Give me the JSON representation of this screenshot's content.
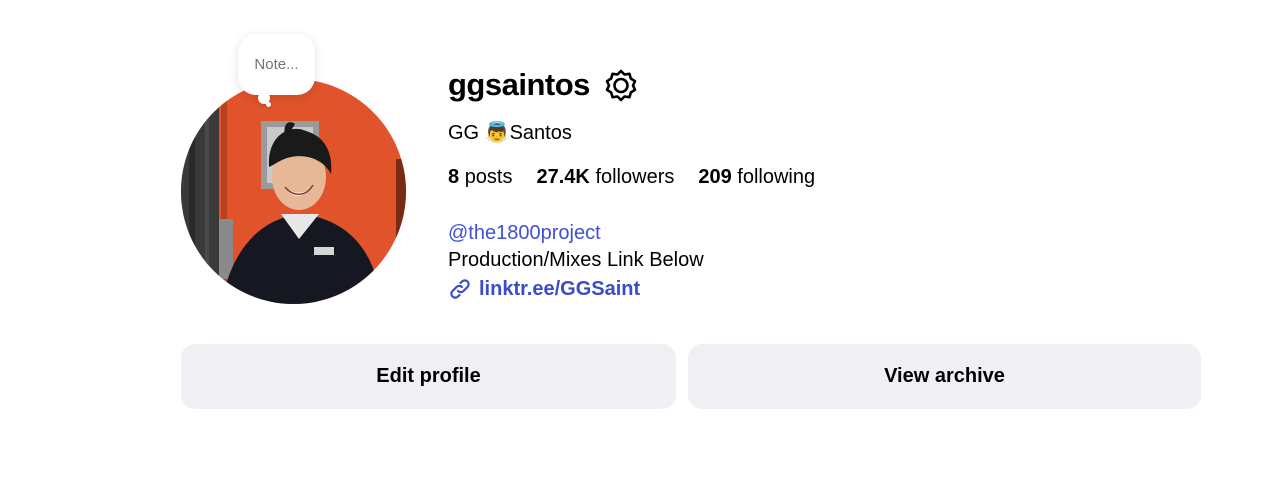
{
  "profile": {
    "note_placeholder": "Note...",
    "username": "ggsaintos",
    "full_name": "GG 👼Santos",
    "stats": {
      "posts_count": "8",
      "posts_label": "posts",
      "followers_count": "27.4K",
      "followers_label": "followers",
      "following_count": "209",
      "following_label": "following"
    },
    "bio": {
      "mention": "@the1800project",
      "text": "Production/Mixes Link Below",
      "link": "linktr.ee/GGSaint"
    }
  },
  "actions": {
    "edit_profile": "Edit profile",
    "view_archive": "View archive"
  },
  "colors": {
    "link": "#3b4cca",
    "button_bg": "#efeff4",
    "avatar_wall": "#e0532b"
  },
  "icons": {
    "settings": "gear-icon",
    "link": "link-icon"
  }
}
